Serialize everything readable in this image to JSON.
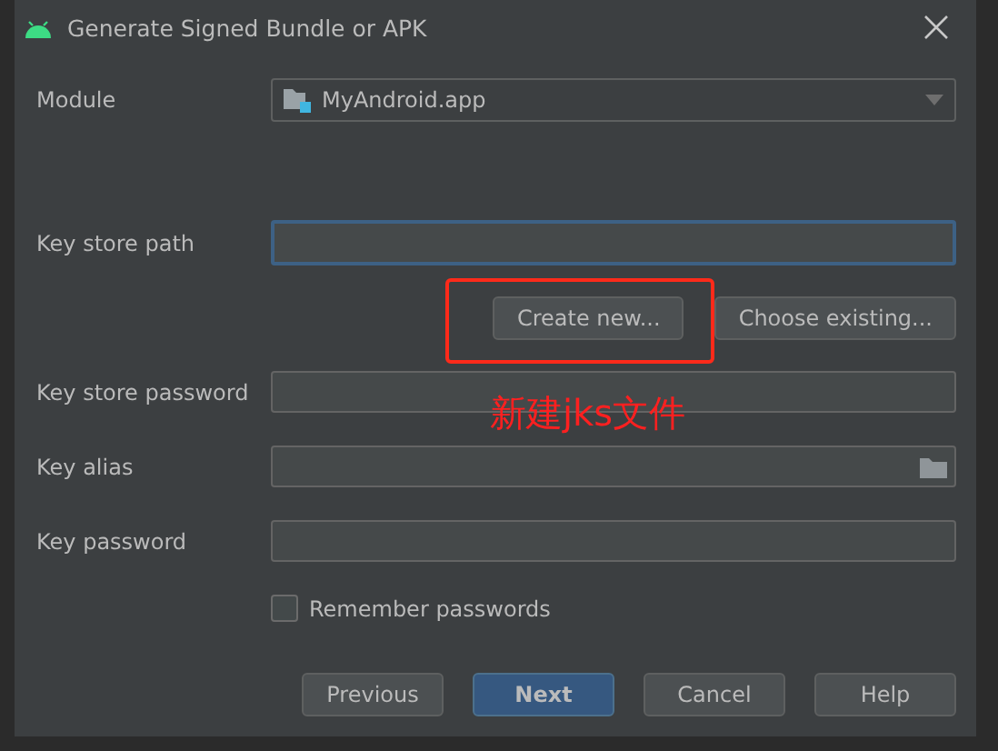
{
  "window": {
    "title": "Generate Signed Bundle or APK"
  },
  "module": {
    "label": "Module",
    "value": "MyAndroid.app"
  },
  "key_store_path": {
    "label": "Key store path",
    "focused": true
  },
  "key_store_buttons": [
    {
      "label": "Create new..."
    },
    {
      "label": "Choose existing..."
    }
  ],
  "fields": [
    {
      "label": "Key store password",
      "kind": "password",
      "focused": false
    },
    {
      "label": "Key alias",
      "kind": "browse",
      "focused": false
    },
    {
      "label": "Key password",
      "kind": "password",
      "focused": false
    }
  ],
  "remember_passwords": {
    "label": "Remember passwords",
    "checked": false
  },
  "buttons": [
    {
      "label": "Previous",
      "default": false
    },
    {
      "label": "Next",
      "default": true
    },
    {
      "label": "Cancel",
      "default": false
    },
    {
      "label": "Help",
      "default": false
    }
  ],
  "annotation": {
    "text": "新建jks文件"
  }
}
